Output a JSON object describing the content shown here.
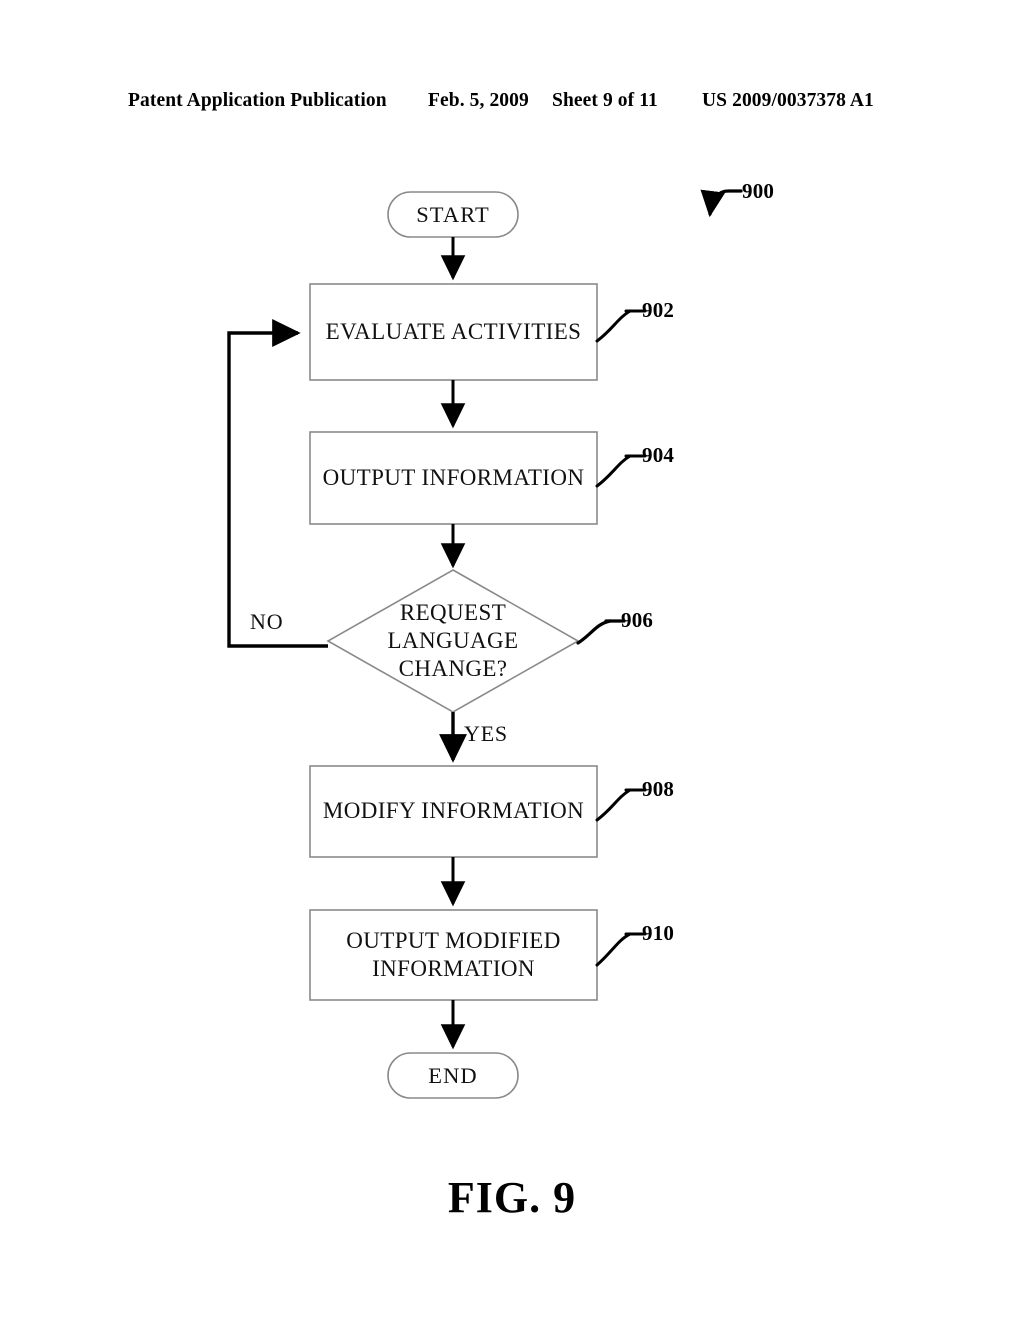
{
  "header": {
    "publication": "Patent Application Publication",
    "date": "Feb. 5, 2009",
    "sheet": "Sheet 9 of 11",
    "patent_number": "US 2009/0037378 A1"
  },
  "figure": {
    "caption": "FIG. 9",
    "diagram_ref": "900",
    "nodes": [
      {
        "id": "start",
        "type": "terminal",
        "label": "START",
        "ref": ""
      },
      {
        "id": "n902",
        "type": "process",
        "label": "EVALUATE ACTIVITIES",
        "ref": "902"
      },
      {
        "id": "n904",
        "type": "process",
        "label": "OUTPUT INFORMATION",
        "ref": "904"
      },
      {
        "id": "n906",
        "type": "decision",
        "label": "REQUEST\nLANGUAGE\nCHANGE?",
        "ref": "906"
      },
      {
        "id": "n908",
        "type": "process",
        "label": "MODIFY INFORMATION",
        "ref": "908"
      },
      {
        "id": "n910",
        "type": "process",
        "label": "OUTPUT MODIFIED\nINFORMATION",
        "ref": "910"
      },
      {
        "id": "end",
        "type": "terminal",
        "label": "END",
        "ref": ""
      }
    ],
    "branches": {
      "no": "NO",
      "yes": "YES"
    },
    "colors": {
      "stroke": "#000000",
      "node_border": "#8a8a8a",
      "background": "#ffffff"
    }
  }
}
